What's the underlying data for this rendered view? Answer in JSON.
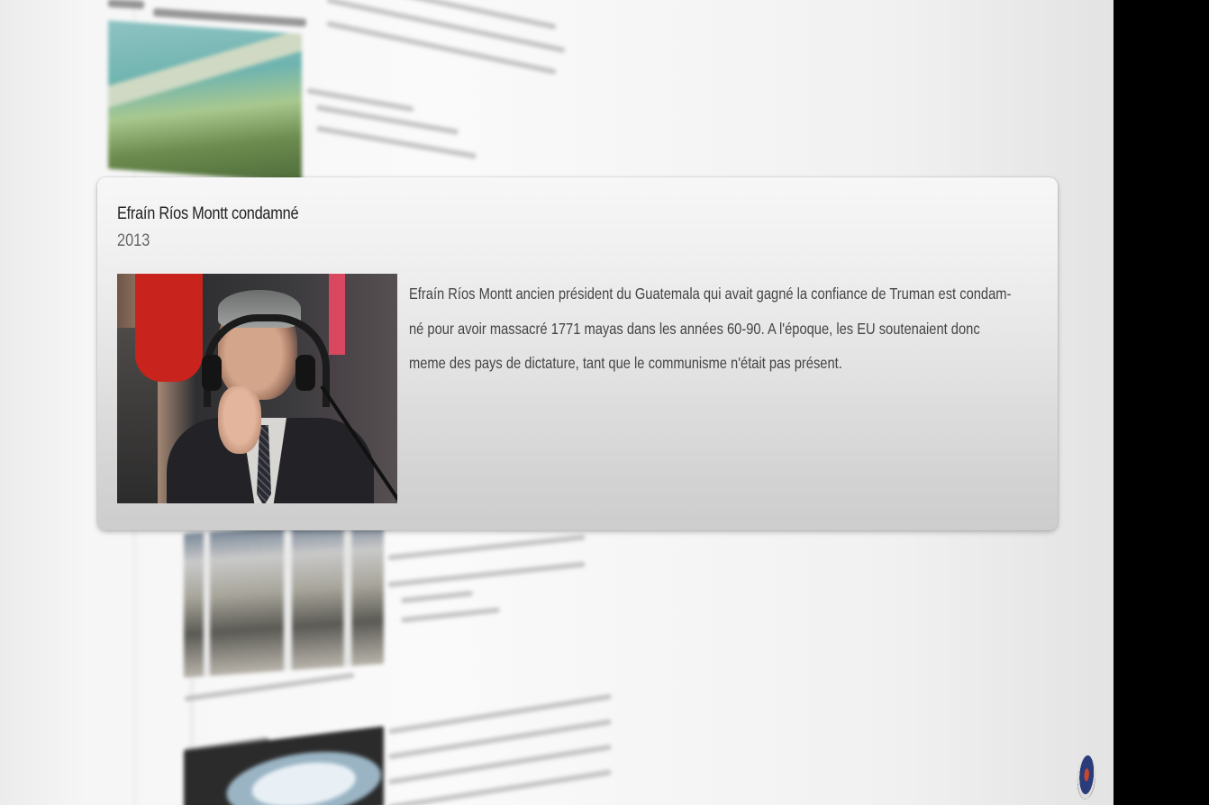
{
  "popup": {
    "title": "Efraín Ríos Montt condamné",
    "date": "2013",
    "image_alt": "Efraín Ríos Montt",
    "body_lines": [
      "Efraín Ríos Montt ancien président du Guatemala qui avait gagné la confiance de Truman est condam-",
      "né pour avoir massacré 1771 mayas dans les années 60-90. A l'époque, les EU soutenaient donc",
      "meme des pays de dictature, tant que le communisme n'était pas présent."
    ]
  },
  "colors": {
    "card_top": "#f7f7f7",
    "card_bottom": "#cdcdcd",
    "title": "#222222",
    "date": "#666666",
    "body": "#444444",
    "edge": "#000000"
  }
}
